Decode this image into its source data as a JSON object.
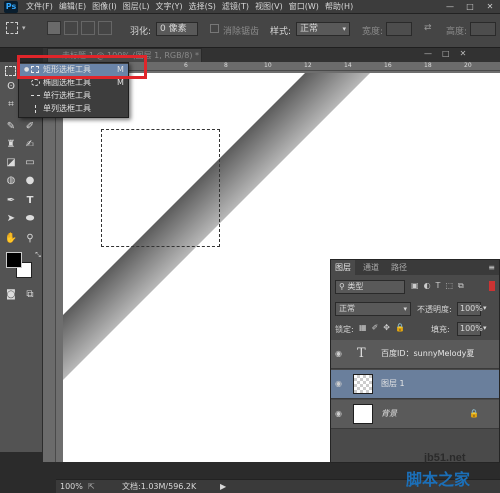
{
  "app": {
    "logo": "Ps"
  },
  "menu": [
    "文件(F)",
    "编辑(E)",
    "图像(I)",
    "图层(L)",
    "文字(Y)",
    "选择(S)",
    "滤镜(T)",
    "视图(V)",
    "窗口(W)",
    "帮助(H)"
  ],
  "options": {
    "feather_label": "羽化:",
    "feather_value": "0 像素",
    "antialias_label": "消除锯齿",
    "style_label": "样式:",
    "style_value": "正常",
    "width_label": "宽度:",
    "height_label": "高度:"
  },
  "document": {
    "tab_title": "未标题-1 @ 100% (图层 1, RGB/8) *"
  },
  "ruler_ticks": [
    "6",
    "8",
    "10",
    "12",
    "14",
    "16",
    "18",
    "20"
  ],
  "tool_menu": {
    "items": [
      {
        "label": "矩形选框工具",
        "shortcut": "M",
        "selected": true
      },
      {
        "label": "椭圆选框工具",
        "shortcut": "M",
        "selected": false
      },
      {
        "label": "单行选框工具",
        "shortcut": "",
        "selected": false
      },
      {
        "label": "单列选框工具",
        "shortcut": "",
        "selected": false
      }
    ]
  },
  "layers_panel": {
    "tabs": [
      "图层",
      "通道",
      "路径"
    ],
    "filter_label": "类型",
    "blend_mode": "正常",
    "opacity_label": "不透明度:",
    "opacity_value": "100%",
    "lock_label": "锁定:",
    "fill_label": "填充:",
    "fill_value": "100%",
    "layers": [
      {
        "name": "百度ID：sunnyMelody夏",
        "type": "text",
        "thumb": "T"
      },
      {
        "name": "图层 1",
        "type": "pixel",
        "selected": true
      },
      {
        "name": "背景",
        "type": "background",
        "locked": true
      }
    ]
  },
  "status": {
    "zoom": "100%",
    "doc_info": "文档:1.03M/596.2K"
  },
  "watermark": {
    "site": "jb51.net",
    "text": "脚本之家"
  },
  "colors": {
    "highlight": "#e0252a",
    "selection": "#6a84a8",
    "foreground": "#000000",
    "background": "#ffffff"
  }
}
